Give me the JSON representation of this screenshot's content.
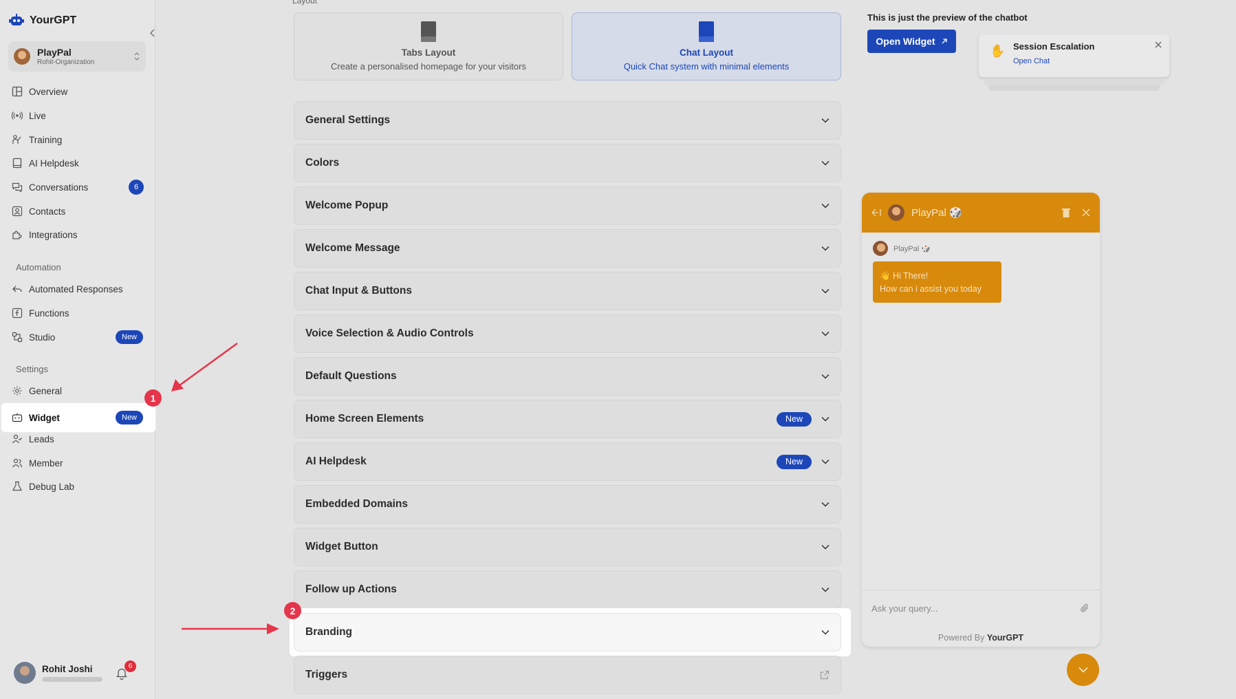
{
  "app": {
    "brand": "YourGPT"
  },
  "org": {
    "name": "PlayPal",
    "subtitle": "Rohit-Organization"
  },
  "sidebar": {
    "items": [
      {
        "label": "Overview",
        "icon": "layout-grid-icon"
      },
      {
        "label": "Live",
        "icon": "broadcast-icon"
      },
      {
        "label": "Training",
        "icon": "training-icon"
      },
      {
        "label": "AI Helpdesk",
        "icon": "book-icon"
      },
      {
        "label": "Conversations",
        "icon": "chat-icon",
        "badge": "6"
      },
      {
        "label": "Contacts",
        "icon": "contact-icon"
      },
      {
        "label": "Integrations",
        "icon": "puzzle-icon"
      }
    ],
    "automation_heading": "Automation",
    "automation_items": [
      {
        "label": "Automated Responses",
        "icon": "reply-icon"
      },
      {
        "label": "Functions",
        "icon": "function-icon"
      },
      {
        "label": "Studio",
        "icon": "studio-icon",
        "badge": "New"
      }
    ],
    "settings_heading": "Settings",
    "settings_items": [
      {
        "label": "General",
        "icon": "gear-icon"
      },
      {
        "label": "Widget",
        "icon": "widget-icon",
        "badge": "New",
        "active": true
      },
      {
        "label": "Leads",
        "icon": "leads-icon"
      },
      {
        "label": "Member",
        "icon": "members-icon"
      },
      {
        "label": "Debug Lab",
        "icon": "flask-icon"
      }
    ],
    "user": {
      "name": "Rohit Joshi",
      "notifications": "6"
    }
  },
  "layout": {
    "heading": "Layout",
    "cards": [
      {
        "title": "Tabs Layout",
        "desc": "Create a personalised homepage for your visitors",
        "selected": false
      },
      {
        "title": "Chat Layout",
        "desc": "Quick Chat system with minimal elements",
        "selected": true
      }
    ]
  },
  "sections": [
    {
      "label": "General Settings"
    },
    {
      "label": "Colors"
    },
    {
      "label": "Welcome Popup"
    },
    {
      "label": "Welcome Message"
    },
    {
      "label": "Chat Input & Buttons"
    },
    {
      "label": "Voice Selection & Audio Controls"
    },
    {
      "label": "Default Questions"
    },
    {
      "label": "Home Screen Elements",
      "badge": "New"
    },
    {
      "label": "AI Helpdesk",
      "badge": "New"
    },
    {
      "label": "Embedded Domains"
    },
    {
      "label": "Widget Button"
    },
    {
      "label": "Follow up Actions"
    },
    {
      "label": "Branding"
    },
    {
      "label": "Triggers"
    }
  ],
  "preview": {
    "note": "This is just the preview of the chatbot",
    "open_widget": "Open Widget",
    "escalation": {
      "title": "Session Escalation",
      "link": "Open Chat"
    },
    "chatbot": {
      "name": "PlayPal 🎲",
      "sender": "PlayPal 🎲",
      "greeting_line1": "👋 Hi There!",
      "greeting_line2": "How can i assist you today",
      "input_placeholder": "Ask your query...",
      "powered_prefix": "Powered By",
      "powered_brand": "YourGPT"
    }
  },
  "annotations": {
    "step1": "1",
    "step2": "2"
  },
  "colors": {
    "brand_blue": "#1d47b8",
    "bot_orange": "#d88a0c",
    "annotation_red": "#e5354a"
  }
}
